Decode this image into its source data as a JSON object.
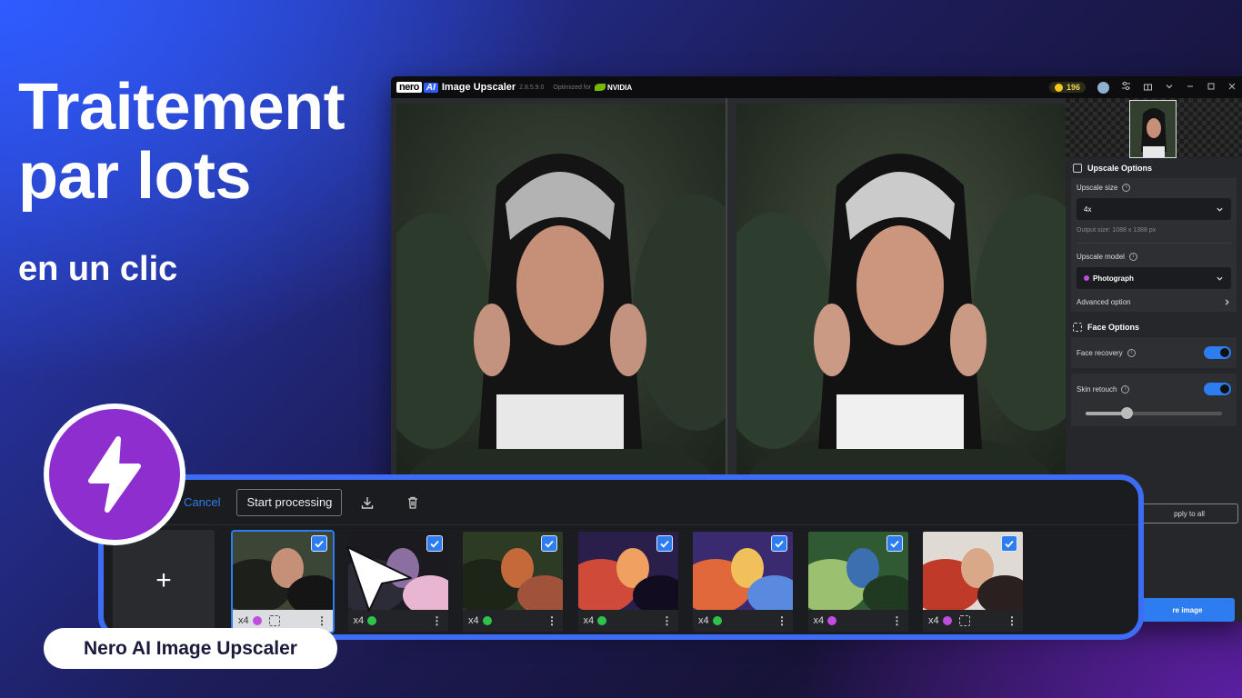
{
  "hero": {
    "title_line1": "Traitement",
    "title_line2": "par lots",
    "subtitle": "en un clic",
    "product_pill": "Nero AI Image Upscaler"
  },
  "app": {
    "brand_nero": "nero",
    "brand_ai": "AI",
    "title": "Image Upscaler",
    "version": "2.8.5.9.0",
    "optimized_for": "Optimized for",
    "nvidia": "NVIDIA",
    "credits": "196"
  },
  "sidepanel": {
    "upscale_options": "Upscale Options",
    "upscale_size_label": "Upscale size",
    "upscale_size_value": "4x",
    "output_size": "Output size: 1088 x 1388 px",
    "upscale_model_label": "Upscale model",
    "upscale_model_value": "Photograph",
    "advanced_option": "Advanced option",
    "face_options": "Face Options",
    "face_recovery": "Face recovery",
    "skin_retouch": "Skin retouch",
    "skin_retouch_level": 0.3,
    "apply_to_all": "pply to all",
    "save_image": "re image"
  },
  "batch": {
    "cancel": "Cancel",
    "start_processing": "Start processing",
    "add": "+",
    "items": [
      {
        "scale": "x4",
        "model_color": "#c04ce0",
        "face": true,
        "selected": true
      },
      {
        "scale": "x4",
        "model_color": "#2ec44a",
        "face": false,
        "selected": false
      },
      {
        "scale": "x4",
        "model_color": "#2ec44a",
        "face": false,
        "selected": false
      },
      {
        "scale": "x4",
        "model_color": "#2ec44a",
        "face": false,
        "selected": false
      },
      {
        "scale": "x4",
        "model_color": "#2ec44a",
        "face": false,
        "selected": false
      },
      {
        "scale": "x4",
        "model_color": "#c04ce0",
        "face": false,
        "selected": false
      },
      {
        "scale": "x4",
        "model_color": "#c04ce0",
        "face": true,
        "selected": false
      }
    ]
  },
  "colors": {
    "accent": "#2d7df0",
    "frame": "#3d6df5",
    "badge": "#8f2ecf"
  }
}
